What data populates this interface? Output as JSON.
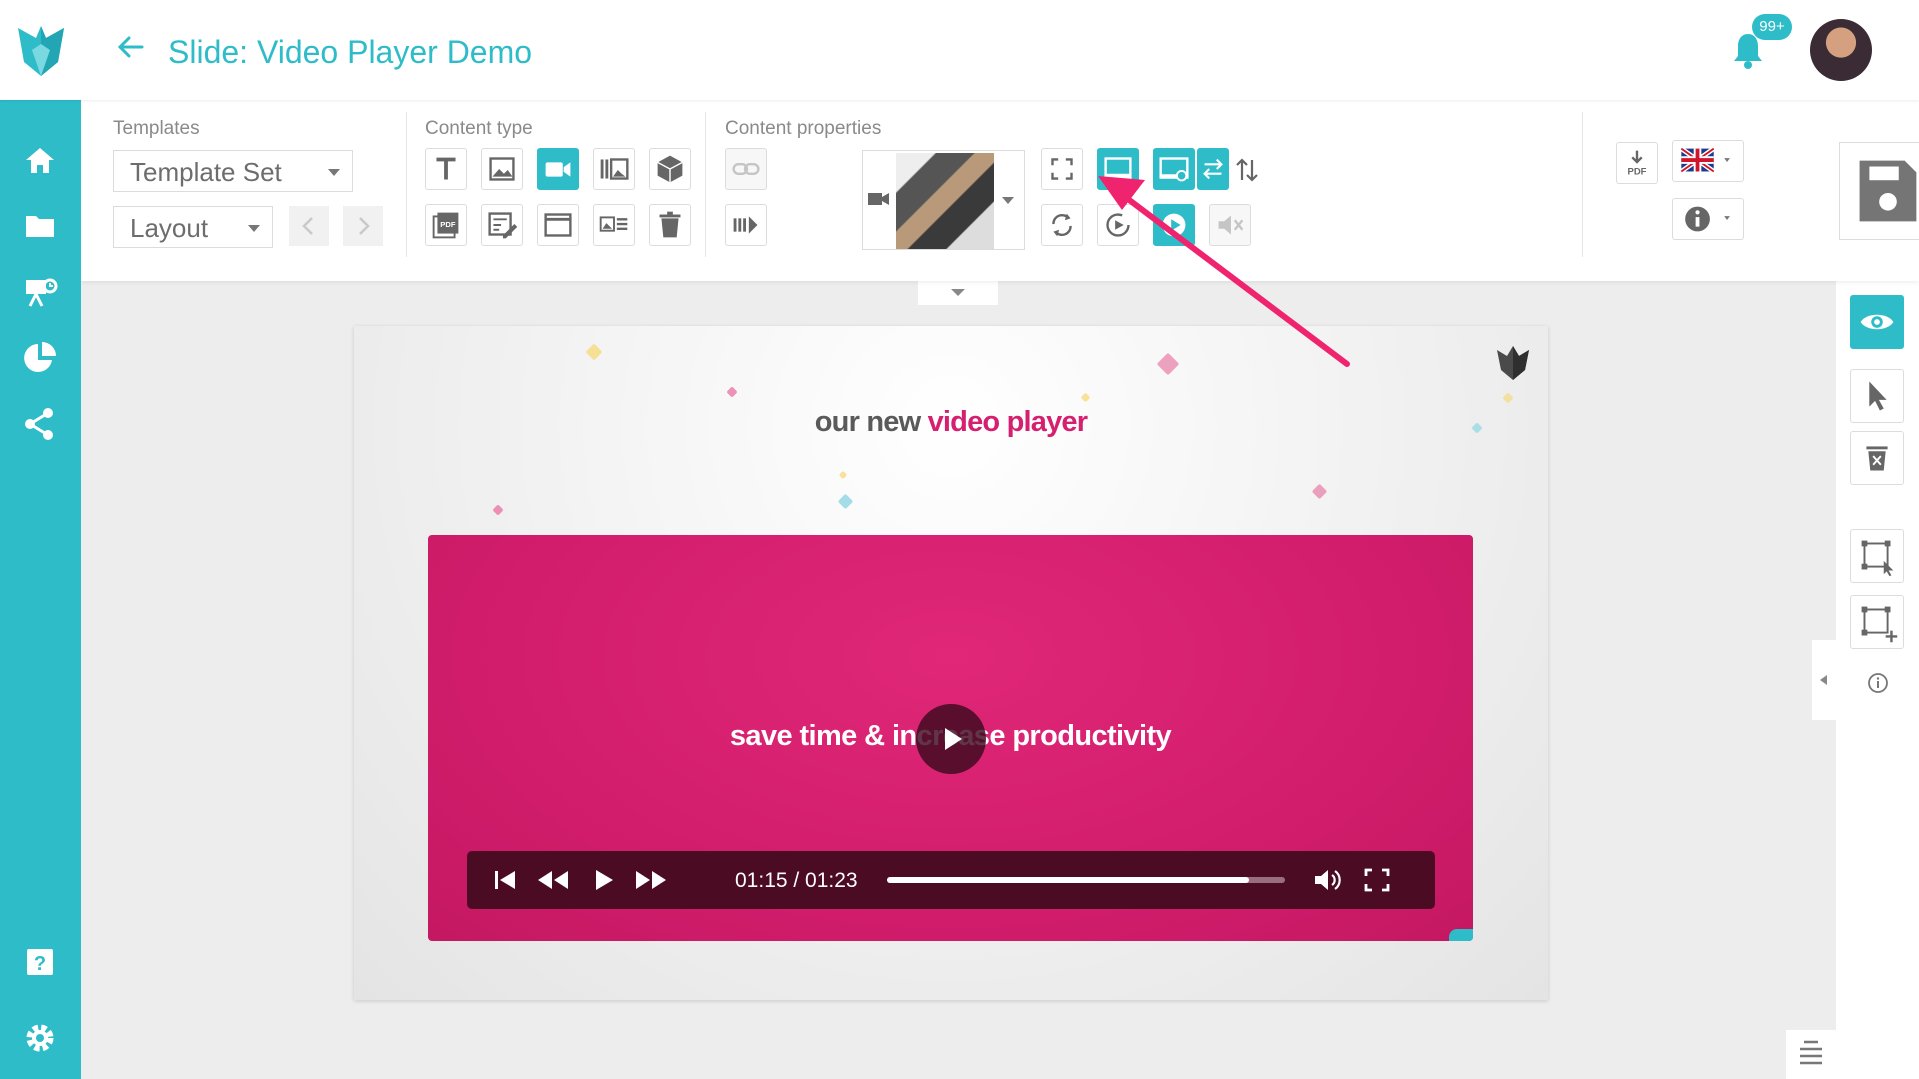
{
  "header": {
    "title": "Slide: Video Player Demo",
    "notification_count": "99+"
  },
  "colors": {
    "accent": "#2fbcc9",
    "brand_pink": "#d51f6f",
    "player_bar": "#4b0b23",
    "annotation_arrow": "#f0246e"
  },
  "sidebar": {
    "items": [
      {
        "icon": "home-icon"
      },
      {
        "icon": "folder-icon"
      },
      {
        "icon": "presentation-icon"
      },
      {
        "icon": "pie-chart-icon"
      },
      {
        "icon": "share-icon"
      },
      {
        "icon": "help-icon"
      },
      {
        "icon": "settings-icon"
      }
    ]
  },
  "toolbar": {
    "templates_label": "Templates",
    "template_set_value": "Template Set",
    "layout_value": "Layout",
    "content_type_label": "Content type",
    "content_properties_label": "Content properties",
    "pdf_icon_text": "PDF"
  },
  "slide": {
    "heading_part1": "our new ",
    "heading_part2": "video player",
    "video_caption": "save time & increase productivity"
  },
  "player": {
    "time": "01:15 / 01:23",
    "progress": 0.91
  }
}
